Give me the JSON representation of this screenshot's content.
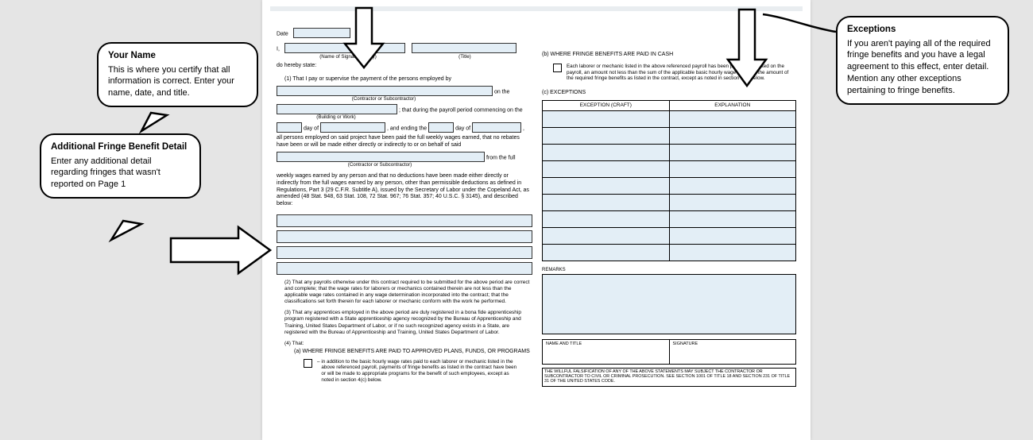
{
  "callouts": {
    "yourName": {
      "title": "Your Name",
      "body": "This is where you certify that all information is correct. Enter your name, date, and title."
    },
    "fringe": {
      "title": "Additional Fringe Benefit Detail",
      "body": "Enter any additional detail regarding fringes that wasn't reported on Page 1"
    },
    "exceptions": {
      "title": "Exceptions",
      "body": "If you aren't paying all of the required fringe benefits and you have a legal agreement to this effect, enter detail. Mention any other exceptions pertaining to fringe benefits."
    }
  },
  "form": {
    "dateLabel": "Date",
    "iLabel": "I,",
    "sigCaption": "(Name of Signatory Party)",
    "titleCaption": "(Title)",
    "hereby": "do hereby state:",
    "s1": "(1) That I pay or supervise the payment of the persons employed by",
    "onThe": "on the",
    "contractorCap1": "(Contractor or Subcontractor)",
    "thatDuring": "; that during the payroll period commencing on the",
    "buildingCap": "(Building or Work)",
    "dayOf1": "day of",
    "andEnding": ", and ending the",
    "dayOf2": "day of",
    "trailComma": ",",
    "allPersons": "all persons employed on said project have been paid the full weekly wages earned, that no rebates have been or will be made either directly or indirectly to or on behalf of said",
    "fromFull": "from the full",
    "contractorCap2": "(Contractor or Subcontractor)",
    "weekly": "weekly wages earned by any person and that no deductions have been made either directly or indirectly from the full wages earned by any person, other than permissible deductions as defined in Regulations, Part 3 (29 C.F.R. Subtitle A), issued by the Secretary of Labor under the Copeland Act, as amended (48 Stat. 948, 63 Stat. 108, 72 Stat. 967; 76 Stat. 357; 40 U.S.C. § 3145), and described below:",
    "s2": "(2) That any payrolls otherwise under this contract required to be submitted for the above period are correct and complete; that the wage rates for laborers or mechanics contained therein are not less than the applicable wage rates contained in any wage determination incorporated into the contract; that the classifications set forth therein for each laborer or mechanic conform with the work he performed.",
    "s3": "(3) That any apprentices employed in the above period are duly registered in a bona fide apprenticeship program registered with a State apprenticeship agency recognized by the Bureau of Apprenticeship and Training, United States Department of Labor, or if no such recognized agency exists in a State, are registered with the Bureau of Apprenticeship and Training, United States Department of Labor.",
    "s4": "(4) That:",
    "s4a": "(a) WHERE FRINGE BENEFITS ARE PAID TO APPROVED PLANS, FUNDS, OR PROGRAMS",
    "s4aBody": "in addition to the basic hourly wage rates paid to each laborer or mechanic listed in the above referenced payroll, payments of fringe benefits as listed in the contract have been or will be made to appropriate programs for the benefit of such employees, except as noted in section 4(c) below.",
    "bTitle": "(b) WHERE FRINGE BENEFITS ARE PAID IN CASH",
    "bBody": "Each laborer or mechanic listed in the above referenced payroll has been paid, as indicated on the payroll, an amount not less than the sum of the applicable basic hourly wage rate plus the amount of the required fringe benefits as listed in the contract, except as noted in section 4(c) below.",
    "cTitle": "(c) EXCEPTIONS",
    "colException": "EXCEPTION (CRAFT)",
    "colExplanation": "EXPLANATION",
    "remarks": "REMARKS",
    "nameTitle": "NAME AND TITLE",
    "signature": "SIGNATURE",
    "disclaimer": "THE WILLFUL FALSIFICATION OF ANY OF THE ABOVE STATEMENTS MAY SUBJECT THE CONTRACTOR OR SUBCONTRACTOR TO CIVIL OR CRIMINAL PROSECUTION. SEE SECTION 1001 OF TITLE 18 AND SECTION 231 OF TITLE 31 OF THE UNITED STATES CODE."
  }
}
